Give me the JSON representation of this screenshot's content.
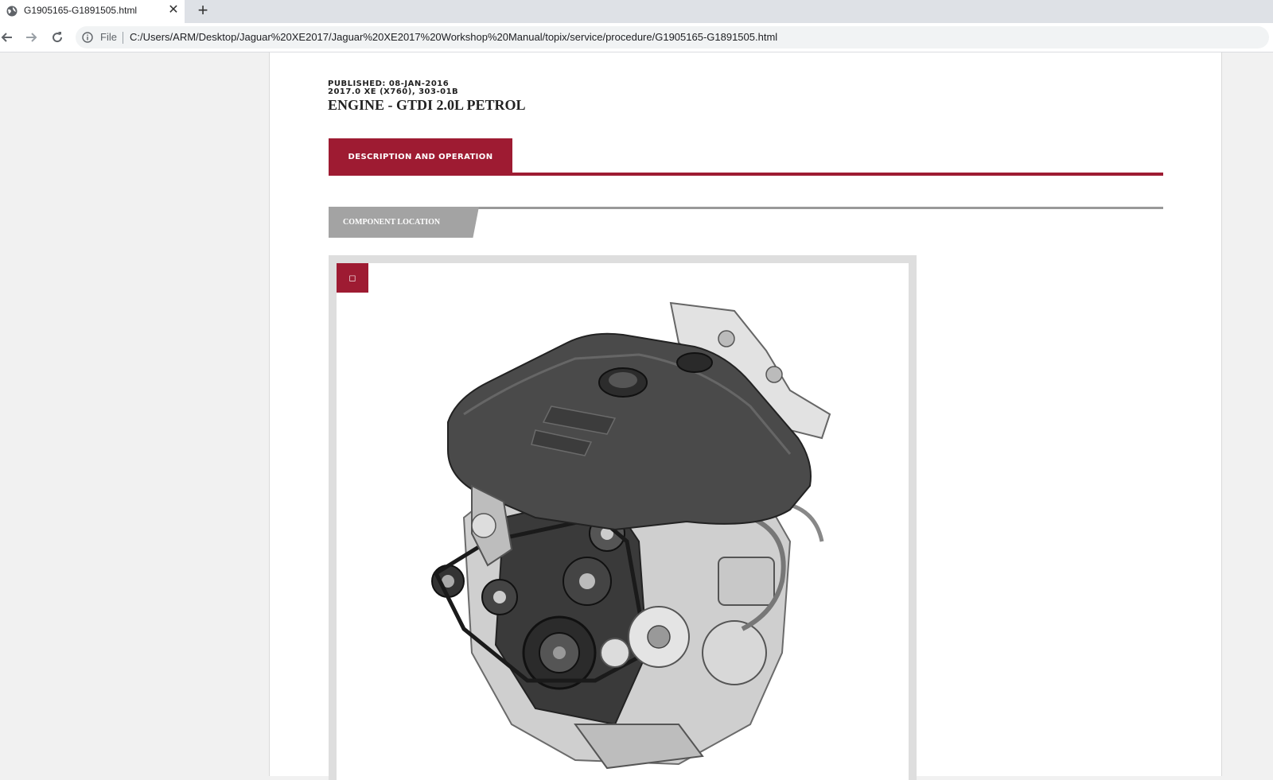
{
  "browser": {
    "tab_title": "G1905165-G1891505.html",
    "tab_close": "✕",
    "new_tab": "+",
    "scheme_label": "File",
    "url": "C:/Users/ARM/Desktop/Jaguar%20XE2017/Jaguar%20XE2017%20Workshop%20Manual/topix/service/procedure/G1905165-G1891505.html"
  },
  "document": {
    "published": "PUBLISHED: 08-JAN-2016",
    "model": "2017.0 XE (X760), 303-01B",
    "title": "ENGINE - GTDI 2.0L PETROL",
    "section_tab": "DESCRIPTION AND OPERATION",
    "subsection_tab": "COMPONENT LOCATION",
    "figure_button": "◻"
  },
  "colors": {
    "accent": "#9e1b32",
    "subsection": "#a3a3a3"
  },
  "icons": [
    "globe-icon",
    "close-icon",
    "plus-icon",
    "back-arrow-icon",
    "forward-arrow-icon",
    "reload-icon",
    "info-icon",
    "expand-icon"
  ]
}
